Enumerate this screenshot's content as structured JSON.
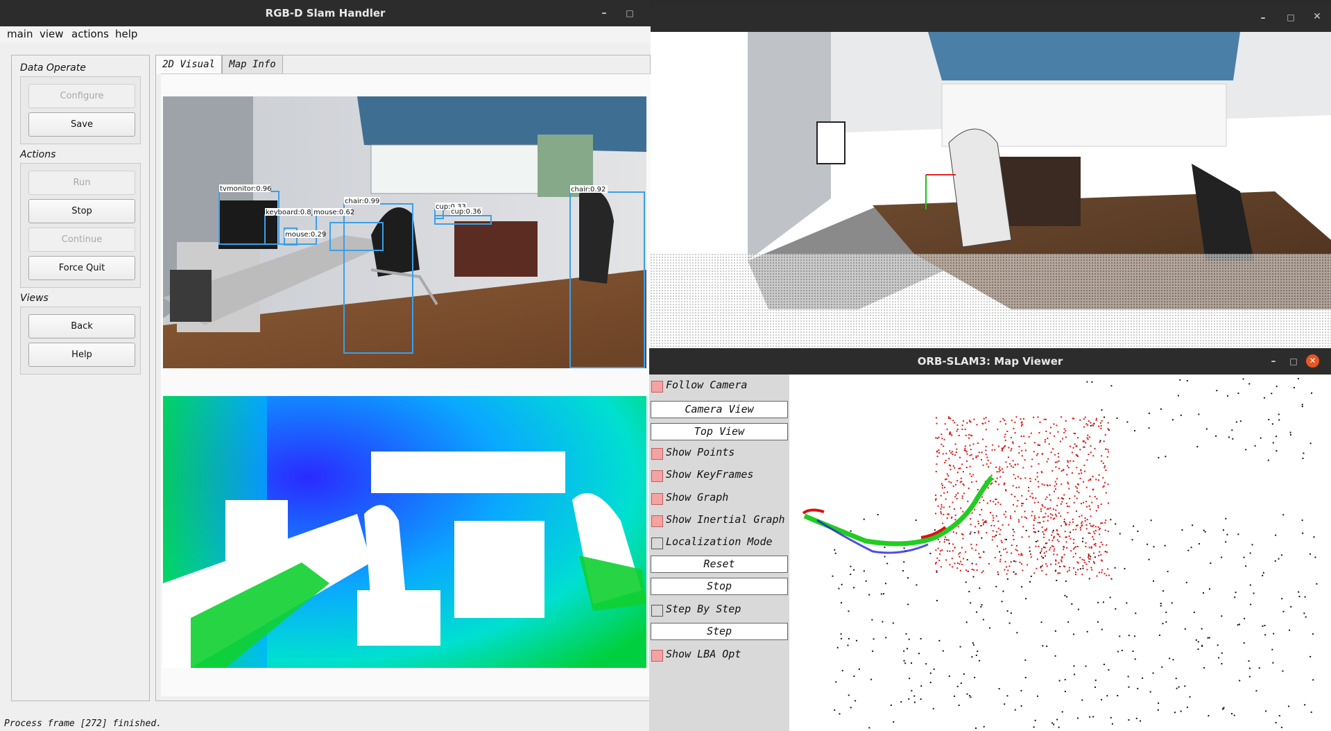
{
  "left_window": {
    "title": "RGB-D Slam Handler",
    "menu": [
      "main",
      "view",
      "actions",
      "help"
    ],
    "sections": {
      "data_operate": "Data Operate",
      "actions": "Actions",
      "views": "Views"
    },
    "buttons": {
      "configure": "Configure",
      "save": "Save",
      "run": "Run",
      "stop": "Stop",
      "continue": "Continue",
      "force_quit": "Force Quit",
      "back": "Back",
      "help": "Help"
    },
    "tabs": [
      "2D Visual",
      "Map Info"
    ],
    "detections": [
      {
        "label": "tvmonitor:0.96"
      },
      {
        "label": "keyboard:0.8"
      },
      {
        "label": "mouse:0.62"
      },
      {
        "label": "mouse:0.29"
      },
      {
        "label": "chair:0.99"
      },
      {
        "label": "cup:0.33"
      },
      {
        "label": "cup:0.36"
      },
      {
        "label": "chair:0.92"
      }
    ],
    "status": "Process frame [272] finished."
  },
  "pointcloud_window": {
    "title": ""
  },
  "map_viewer": {
    "title": "ORB-SLAM3: Map Viewer",
    "controls": [
      {
        "type": "check",
        "label": "Follow Camera",
        "checked": true
      },
      {
        "type": "button",
        "label": "Camera View"
      },
      {
        "type": "button",
        "label": "Top View"
      },
      {
        "type": "check",
        "label": "Show Points",
        "checked": true
      },
      {
        "type": "check",
        "label": "Show KeyFrames",
        "checked": true
      },
      {
        "type": "check",
        "label": "Show Graph",
        "checked": true
      },
      {
        "type": "check",
        "label": "Show Inertial Graph",
        "checked": true
      },
      {
        "type": "check",
        "label": "Localization Mode",
        "checked": false
      },
      {
        "type": "button",
        "label": "Reset"
      },
      {
        "type": "button",
        "label": "Stop"
      },
      {
        "type": "check",
        "label": "Step By Step",
        "checked": false
      },
      {
        "type": "button",
        "label": "Step"
      },
      {
        "type": "check",
        "label": "Show LBA Opt",
        "checked": true
      }
    ]
  },
  "icons": {
    "minimize": "minimize-icon",
    "maximize": "maximize-icon",
    "close": "close-icon"
  },
  "colors": {
    "titlebar": "#2c2c2c",
    "detection_box": "#3aa0e8",
    "checkbox_on": "#f4a3a3",
    "close_button": "#e95420",
    "trajectory": "#22cc22",
    "map_points": "#e01010"
  }
}
